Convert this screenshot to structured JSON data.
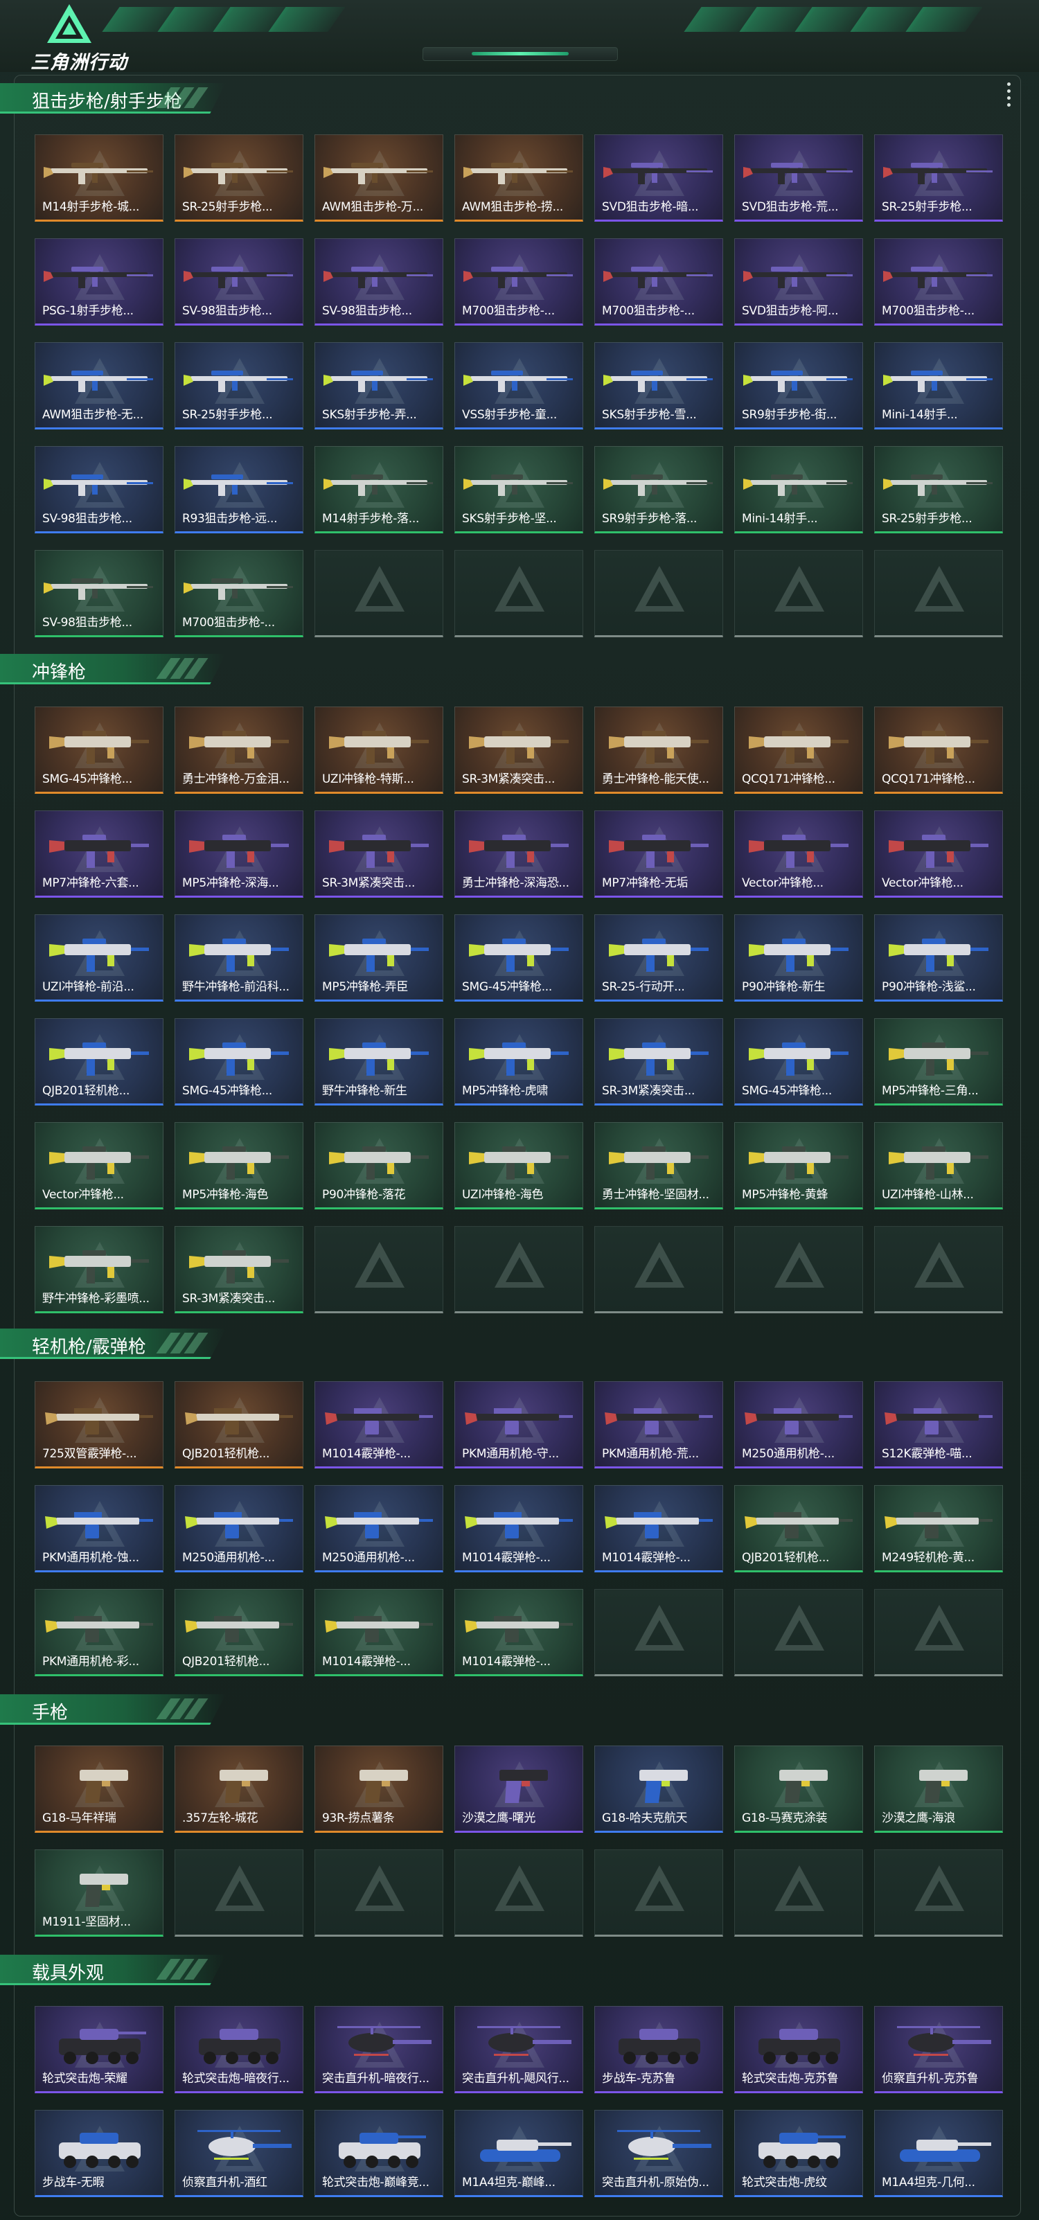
{
  "header": {
    "logo_text": "三角洲行动"
  },
  "sections": [
    {
      "title": "狙击步枪/射手步枪",
      "items": [
        {
          "name": "M14射手步枪-城...",
          "rarity": "gold",
          "icon": "rifle-icon"
        },
        {
          "name": "SR-25射手步枪...",
          "rarity": "gold",
          "icon": "rifle-icon"
        },
        {
          "name": "AWM狙击步枪-万...",
          "rarity": "gold",
          "icon": "rifle-icon"
        },
        {
          "name": "AWM狙击步枪-捞...",
          "rarity": "gold",
          "icon": "rifle-icon"
        },
        {
          "name": "SVD狙击步枪-暗...",
          "rarity": "purple",
          "icon": "rifle-icon"
        },
        {
          "name": "SVD狙击步枪-荒...",
          "rarity": "purple",
          "icon": "rifle-icon"
        },
        {
          "name": "SR-25射手步枪...",
          "rarity": "purple",
          "icon": "rifle-icon"
        },
        {
          "name": "PSG-1射手步枪...",
          "rarity": "purple",
          "icon": "rifle-icon"
        },
        {
          "name": "SV-98狙击步枪...",
          "rarity": "purple",
          "icon": "rifle-icon"
        },
        {
          "name": "SV-98狙击步枪...",
          "rarity": "purple",
          "icon": "rifle-icon"
        },
        {
          "name": "M700狙击步枪-...",
          "rarity": "purple",
          "icon": "rifle-icon"
        },
        {
          "name": "M700狙击步枪-...",
          "rarity": "purple",
          "icon": "rifle-icon"
        },
        {
          "name": "SVD狙击步枪-阿...",
          "rarity": "purple",
          "icon": "rifle-icon"
        },
        {
          "name": "M700狙击步枪-...",
          "rarity": "purple",
          "icon": "rifle-icon"
        },
        {
          "name": "AWM狙击步枪-无...",
          "rarity": "blue",
          "icon": "rifle-icon"
        },
        {
          "name": "SR-25射手步枪...",
          "rarity": "blue",
          "icon": "rifle-icon"
        },
        {
          "name": "SKS射手步枪-弄...",
          "rarity": "blue",
          "icon": "rifle-icon"
        },
        {
          "name": "VSS射手步枪-童...",
          "rarity": "blue",
          "icon": "rifle-icon"
        },
        {
          "name": "SKS射手步枪-雪...",
          "rarity": "blue",
          "icon": "rifle-icon"
        },
        {
          "name": "SR9射手步枪-街...",
          "rarity": "blue",
          "icon": "rifle-icon"
        },
        {
          "name": "Mini-14射手...",
          "rarity": "blue",
          "icon": "rifle-icon"
        },
        {
          "name": "SV-98狙击步枪...",
          "rarity": "blue",
          "icon": "rifle-icon"
        },
        {
          "name": "R93狙击步枪-远...",
          "rarity": "blue",
          "icon": "rifle-icon"
        },
        {
          "name": "M14射手步枪-落...",
          "rarity": "green",
          "icon": "rifle-icon"
        },
        {
          "name": "SKS射手步枪-坚...",
          "rarity": "green",
          "icon": "rifle-icon"
        },
        {
          "name": "SR9射手步枪-落...",
          "rarity": "green",
          "icon": "rifle-icon"
        },
        {
          "name": "Mini-14射手...",
          "rarity": "green",
          "icon": "rifle-icon"
        },
        {
          "name": "SR-25射手步枪...",
          "rarity": "green",
          "icon": "rifle-icon"
        },
        {
          "name": "SV-98狙击步枪...",
          "rarity": "green",
          "icon": "rifle-icon"
        },
        {
          "name": "M700狙击步枪-...",
          "rarity": "green",
          "icon": "rifle-icon"
        },
        {
          "name": "",
          "rarity": "empty"
        },
        {
          "name": "",
          "rarity": "empty"
        },
        {
          "name": "",
          "rarity": "empty"
        },
        {
          "name": "",
          "rarity": "empty"
        },
        {
          "name": "",
          "rarity": "empty"
        }
      ]
    },
    {
      "title": "冲锋枪",
      "items": [
        {
          "name": "SMG-45冲锋枪...",
          "rarity": "gold",
          "icon": "smg-icon"
        },
        {
          "name": "勇士冲锋枪-万金泪...",
          "rarity": "gold",
          "icon": "smg-icon"
        },
        {
          "name": "UZI冲锋枪-特斯...",
          "rarity": "gold",
          "icon": "smg-icon"
        },
        {
          "name": "SR-3M紧凑突击...",
          "rarity": "gold",
          "icon": "smg-icon"
        },
        {
          "name": "勇士冲锋枪-能天使...",
          "rarity": "gold",
          "icon": "smg-icon"
        },
        {
          "name": "QCQ171冲锋枪...",
          "rarity": "gold",
          "icon": "smg-icon"
        },
        {
          "name": "QCQ171冲锋枪...",
          "rarity": "gold",
          "icon": "smg-icon"
        },
        {
          "name": "MP7冲锋枪-六套...",
          "rarity": "purple",
          "icon": "smg-icon"
        },
        {
          "name": "MP5冲锋枪-深海...",
          "rarity": "purple",
          "icon": "smg-icon"
        },
        {
          "name": "SR-3M紧凑突击...",
          "rarity": "purple",
          "icon": "smg-icon"
        },
        {
          "name": "勇士冲锋枪-深海恐...",
          "rarity": "purple",
          "icon": "smg-icon"
        },
        {
          "name": "MP7冲锋枪-无垢",
          "rarity": "purple",
          "icon": "smg-icon"
        },
        {
          "name": "Vector冲锋枪...",
          "rarity": "purple",
          "icon": "smg-icon"
        },
        {
          "name": "Vector冲锋枪...",
          "rarity": "purple",
          "icon": "smg-icon"
        },
        {
          "name": "UZI冲锋枪-前沿...",
          "rarity": "blue",
          "icon": "smg-icon"
        },
        {
          "name": "野牛冲锋枪-前沿科...",
          "rarity": "blue",
          "icon": "smg-icon"
        },
        {
          "name": "MP5冲锋枪-弄臣",
          "rarity": "blue",
          "icon": "smg-icon"
        },
        {
          "name": "SMG-45冲锋枪...",
          "rarity": "blue",
          "icon": "smg-icon"
        },
        {
          "name": "SR-25-行动开...",
          "rarity": "blue",
          "icon": "smg-icon"
        },
        {
          "name": "P90冲锋枪-新生",
          "rarity": "blue",
          "icon": "smg-icon"
        },
        {
          "name": "P90冲锋枪-浅鲨...",
          "rarity": "blue",
          "icon": "smg-icon"
        },
        {
          "name": "QJB201轻机枪...",
          "rarity": "blue",
          "icon": "smg-icon"
        },
        {
          "name": "SMG-45冲锋枪...",
          "rarity": "blue",
          "icon": "smg-icon"
        },
        {
          "name": "野牛冲锋枪-新生",
          "rarity": "blue",
          "icon": "smg-icon"
        },
        {
          "name": "MP5冲锋枪-虎啸",
          "rarity": "blue",
          "icon": "smg-icon"
        },
        {
          "name": "SR-3M紧凑突击...",
          "rarity": "blue",
          "icon": "smg-icon"
        },
        {
          "name": "SMG-45冲锋枪...",
          "rarity": "blue",
          "icon": "smg-icon"
        },
        {
          "name": "MP5冲锋枪-三角...",
          "rarity": "green",
          "icon": "smg-icon"
        },
        {
          "name": "Vector冲锋枪...",
          "rarity": "green",
          "icon": "smg-icon"
        },
        {
          "name": "MP5冲锋枪-海色",
          "rarity": "green",
          "icon": "smg-icon"
        },
        {
          "name": "P90冲锋枪-落花",
          "rarity": "green",
          "icon": "smg-icon"
        },
        {
          "name": "UZI冲锋枪-海色",
          "rarity": "green",
          "icon": "smg-icon"
        },
        {
          "name": "勇士冲锋枪-坚固材...",
          "rarity": "green",
          "icon": "smg-icon"
        },
        {
          "name": "MP5冲锋枪-黄蜂",
          "rarity": "green",
          "icon": "smg-icon"
        },
        {
          "name": "UZI冲锋枪-山林...",
          "rarity": "green",
          "icon": "smg-icon"
        },
        {
          "name": "野牛冲锋枪-彩墨喷...",
          "rarity": "green",
          "icon": "smg-icon"
        },
        {
          "name": "SR-3M紧凑突击...",
          "rarity": "green",
          "icon": "smg-icon"
        },
        {
          "name": "",
          "rarity": "empty"
        },
        {
          "name": "",
          "rarity": "empty"
        },
        {
          "name": "",
          "rarity": "empty"
        },
        {
          "name": "",
          "rarity": "empty"
        },
        {
          "name": "",
          "rarity": "empty"
        }
      ]
    },
    {
      "title": "轻机枪/霰弹枪",
      "items": [
        {
          "name": "725双管霰弹枪-...",
          "rarity": "gold",
          "icon": "lmg-icon"
        },
        {
          "name": "QJB201轻机枪...",
          "rarity": "gold",
          "icon": "lmg-icon"
        },
        {
          "name": "M1014霰弹枪-...",
          "rarity": "purple",
          "icon": "lmg-icon"
        },
        {
          "name": "PKM通用机枪-守...",
          "rarity": "purple",
          "icon": "lmg-icon"
        },
        {
          "name": "PKM通用机枪-荒...",
          "rarity": "purple",
          "icon": "lmg-icon"
        },
        {
          "name": "M250通用机枪-...",
          "rarity": "purple",
          "icon": "lmg-icon"
        },
        {
          "name": "S12K霰弹枪-喵...",
          "rarity": "purple",
          "icon": "lmg-icon"
        },
        {
          "name": "PKM通用机枪-蚀...",
          "rarity": "blue",
          "icon": "lmg-icon"
        },
        {
          "name": "M250通用机枪-...",
          "rarity": "blue",
          "icon": "lmg-icon"
        },
        {
          "name": "M250通用机枪-...",
          "rarity": "blue",
          "icon": "lmg-icon"
        },
        {
          "name": "M1014霰弹枪-...",
          "rarity": "blue",
          "icon": "lmg-icon"
        },
        {
          "name": "M1014霰弹枪-...",
          "rarity": "blue",
          "icon": "lmg-icon"
        },
        {
          "name": "QJB201轻机枪...",
          "rarity": "green",
          "icon": "lmg-icon"
        },
        {
          "name": "M249轻机枪-黄...",
          "rarity": "green",
          "icon": "lmg-icon"
        },
        {
          "name": "PKM通用机枪-彩...",
          "rarity": "green",
          "icon": "lmg-icon"
        },
        {
          "name": "QJB201轻机枪...",
          "rarity": "green",
          "icon": "lmg-icon"
        },
        {
          "name": "M1014霰弹枪-...",
          "rarity": "green",
          "icon": "lmg-icon"
        },
        {
          "name": "M1014霰弹枪-...",
          "rarity": "green",
          "icon": "lmg-icon"
        },
        {
          "name": "",
          "rarity": "empty"
        },
        {
          "name": "",
          "rarity": "empty"
        },
        {
          "name": "",
          "rarity": "empty"
        }
      ]
    },
    {
      "title": "手枪",
      "items": [
        {
          "name": "G18-马年祥瑞",
          "rarity": "gold",
          "icon": "pistol-icon"
        },
        {
          "name": ".357左轮-城花",
          "rarity": "gold",
          "icon": "pistol-icon"
        },
        {
          "name": "93R-捞点薯条",
          "rarity": "gold",
          "icon": "pistol-icon"
        },
        {
          "name": "沙漠之鹰-曙光",
          "rarity": "purple",
          "icon": "pistol-icon"
        },
        {
          "name": "G18-哈夫克航天",
          "rarity": "blue",
          "icon": "pistol-icon"
        },
        {
          "name": "G18-马赛克涂装",
          "rarity": "green",
          "icon": "pistol-icon"
        },
        {
          "name": "沙漠之鹰-海浪",
          "rarity": "green",
          "icon": "pistol-icon"
        },
        {
          "name": "M1911-坚固材...",
          "rarity": "green",
          "icon": "pistol-icon"
        },
        {
          "name": "",
          "rarity": "empty"
        },
        {
          "name": "",
          "rarity": "empty"
        },
        {
          "name": "",
          "rarity": "empty"
        },
        {
          "name": "",
          "rarity": "empty"
        },
        {
          "name": "",
          "rarity": "empty"
        },
        {
          "name": "",
          "rarity": "empty"
        }
      ]
    },
    {
      "title": "载具外观",
      "items": [
        {
          "name": "轮式突击炮-荣耀",
          "rarity": "purple",
          "icon": "vehicle-icon"
        },
        {
          "name": "轮式突击炮-暗夜行...",
          "rarity": "purple",
          "icon": "vehicle-icon"
        },
        {
          "name": "突击直升机-暗夜行...",
          "rarity": "purple",
          "icon": "helicopter-icon"
        },
        {
          "name": "突击直升机-飓风行...",
          "rarity": "purple",
          "icon": "helicopter-icon"
        },
        {
          "name": "步战车-克苏鲁",
          "rarity": "purple",
          "icon": "vehicle-icon"
        },
        {
          "name": "轮式突击炮-克苏鲁",
          "rarity": "purple",
          "icon": "vehicle-icon"
        },
        {
          "name": "侦察直升机-克苏鲁",
          "rarity": "purple",
          "icon": "helicopter-icon"
        },
        {
          "name": "步战车-无暇",
          "rarity": "blue",
          "icon": "vehicle-icon"
        },
        {
          "name": "侦察直升机-酒红",
          "rarity": "blue",
          "icon": "helicopter-icon"
        },
        {
          "name": "轮式突击炮-巅峰竞...",
          "rarity": "blue",
          "icon": "vehicle-icon"
        },
        {
          "name": "M1A4坦克-巅峰...",
          "rarity": "blue",
          "icon": "tank-icon"
        },
        {
          "name": "突击直升机-原始伪...",
          "rarity": "blue",
          "icon": "helicopter-icon"
        },
        {
          "name": "轮式突击炮-虎纹",
          "rarity": "blue",
          "icon": "vehicle-icon"
        },
        {
          "name": "M1A4坦克-几何...",
          "rarity": "blue",
          "icon": "tank-icon"
        }
      ]
    }
  ],
  "colors": {
    "gold": "#e08a2a",
    "purple": "#7b55e8",
    "blue": "#3f7cf0",
    "green": "#2fc06a",
    "section_accent": "#36c27a"
  }
}
